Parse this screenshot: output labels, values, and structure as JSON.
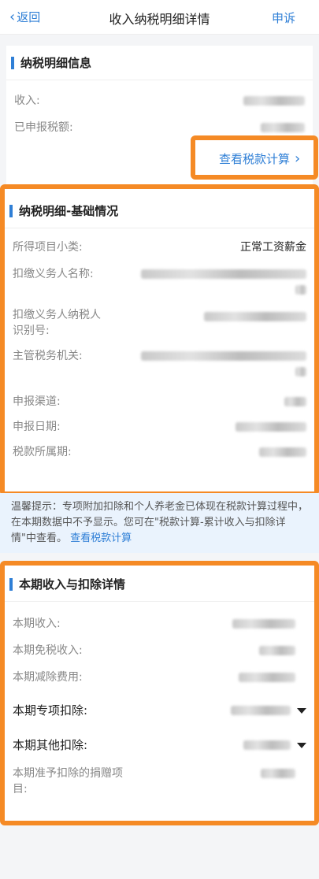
{
  "nav": {
    "back_label": "返回",
    "title": "收入纳税明细详情",
    "appeal_label": "申诉"
  },
  "info": {
    "title": "纳税明细信息",
    "income_label": "收入:",
    "declared_tax_label": "已申报税额:",
    "calc_link": "查看税款计算"
  },
  "basic": {
    "title": "纳税明细-基础情况",
    "rows": [
      {
        "label": "所得项目小类:",
        "value": "正常工资薪金"
      },
      {
        "label": "扣缴义务人名称:"
      },
      {
        "label_line1": "扣缴义务人纳税人",
        "label_line2": "识别号:"
      },
      {
        "label": "主管税务机关:"
      },
      {
        "label": "申报渠道:"
      },
      {
        "label": "申报日期:"
      },
      {
        "label": "税款所属期:"
      }
    ]
  },
  "tip": {
    "text": "温馨提示：专项附加扣除和个人养老金已体现在税款计算过程中，在本期数据中不予显示。您可在\"税款计算-累计收入与扣除详情\"中查看。",
    "link": "查看税款计算"
  },
  "detail": {
    "title": "本期收入与扣除详情",
    "rows": [
      {
        "label": "本期收入:"
      },
      {
        "label": "本期免税收入:"
      },
      {
        "label": "本期减除费用:"
      },
      {
        "label": "本期专项扣除:"
      },
      {
        "label": "本期其他扣除:"
      },
      {
        "label_line1": "本期准予扣除的捐赠项",
        "label_line2": "目:"
      }
    ]
  },
  "colors": {
    "accent": "#2f7fd6",
    "highlight": "#f58a25"
  },
  "icons": [
    "chevron-left-icon",
    "chevron-right-icon",
    "caret-down-icon"
  ]
}
